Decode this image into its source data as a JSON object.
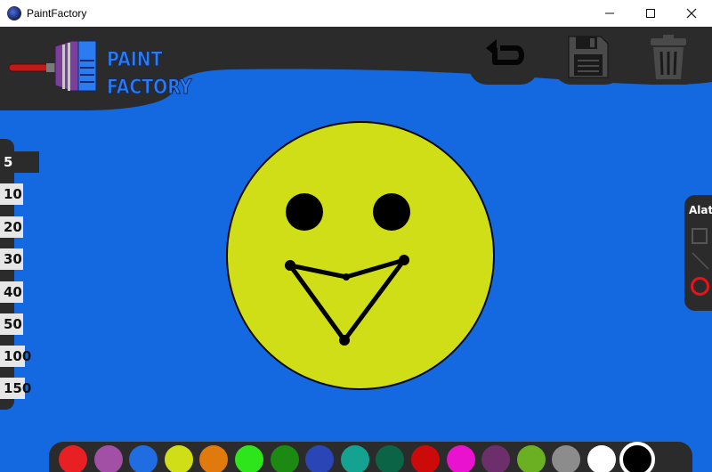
{
  "window": {
    "title": "PaintFactory",
    "controls": [
      "minimize",
      "maximize",
      "close"
    ]
  },
  "logo": {
    "line1": "PAINT",
    "line2": "FACTORY"
  },
  "toolbar": {
    "buttons": [
      {
        "name": "undo",
        "icon": "undo-icon"
      },
      {
        "name": "save",
        "icon": "floppy-icon"
      },
      {
        "name": "clear",
        "icon": "trash-icon"
      }
    ]
  },
  "brush_sizes": {
    "items": [
      "5",
      "10",
      "20",
      "30",
      "40",
      "50",
      "100",
      "150"
    ],
    "selected": "5"
  },
  "shape_tools": {
    "title": "Alati",
    "items": [
      "rectangle",
      "line",
      "circle"
    ],
    "selected": "circle"
  },
  "palette": {
    "colors": [
      "#e82024",
      "#a24fa6",
      "#1f6de0",
      "#cfde16",
      "#e07a0c",
      "#2ee41a",
      "#1c8a12",
      "#2a45b6",
      "#13a390",
      "#0b6446",
      "#cc0a0a",
      "#e812cf",
      "#6c2f6c",
      "#6bb022",
      "#8c8c8c",
      "#ffffff",
      "#000000"
    ],
    "selected": "#000000"
  },
  "colors": {
    "canvas_background": "#1469e0",
    "panel_dark": "#2b2b2b",
    "face_fill": "#cfde16"
  }
}
